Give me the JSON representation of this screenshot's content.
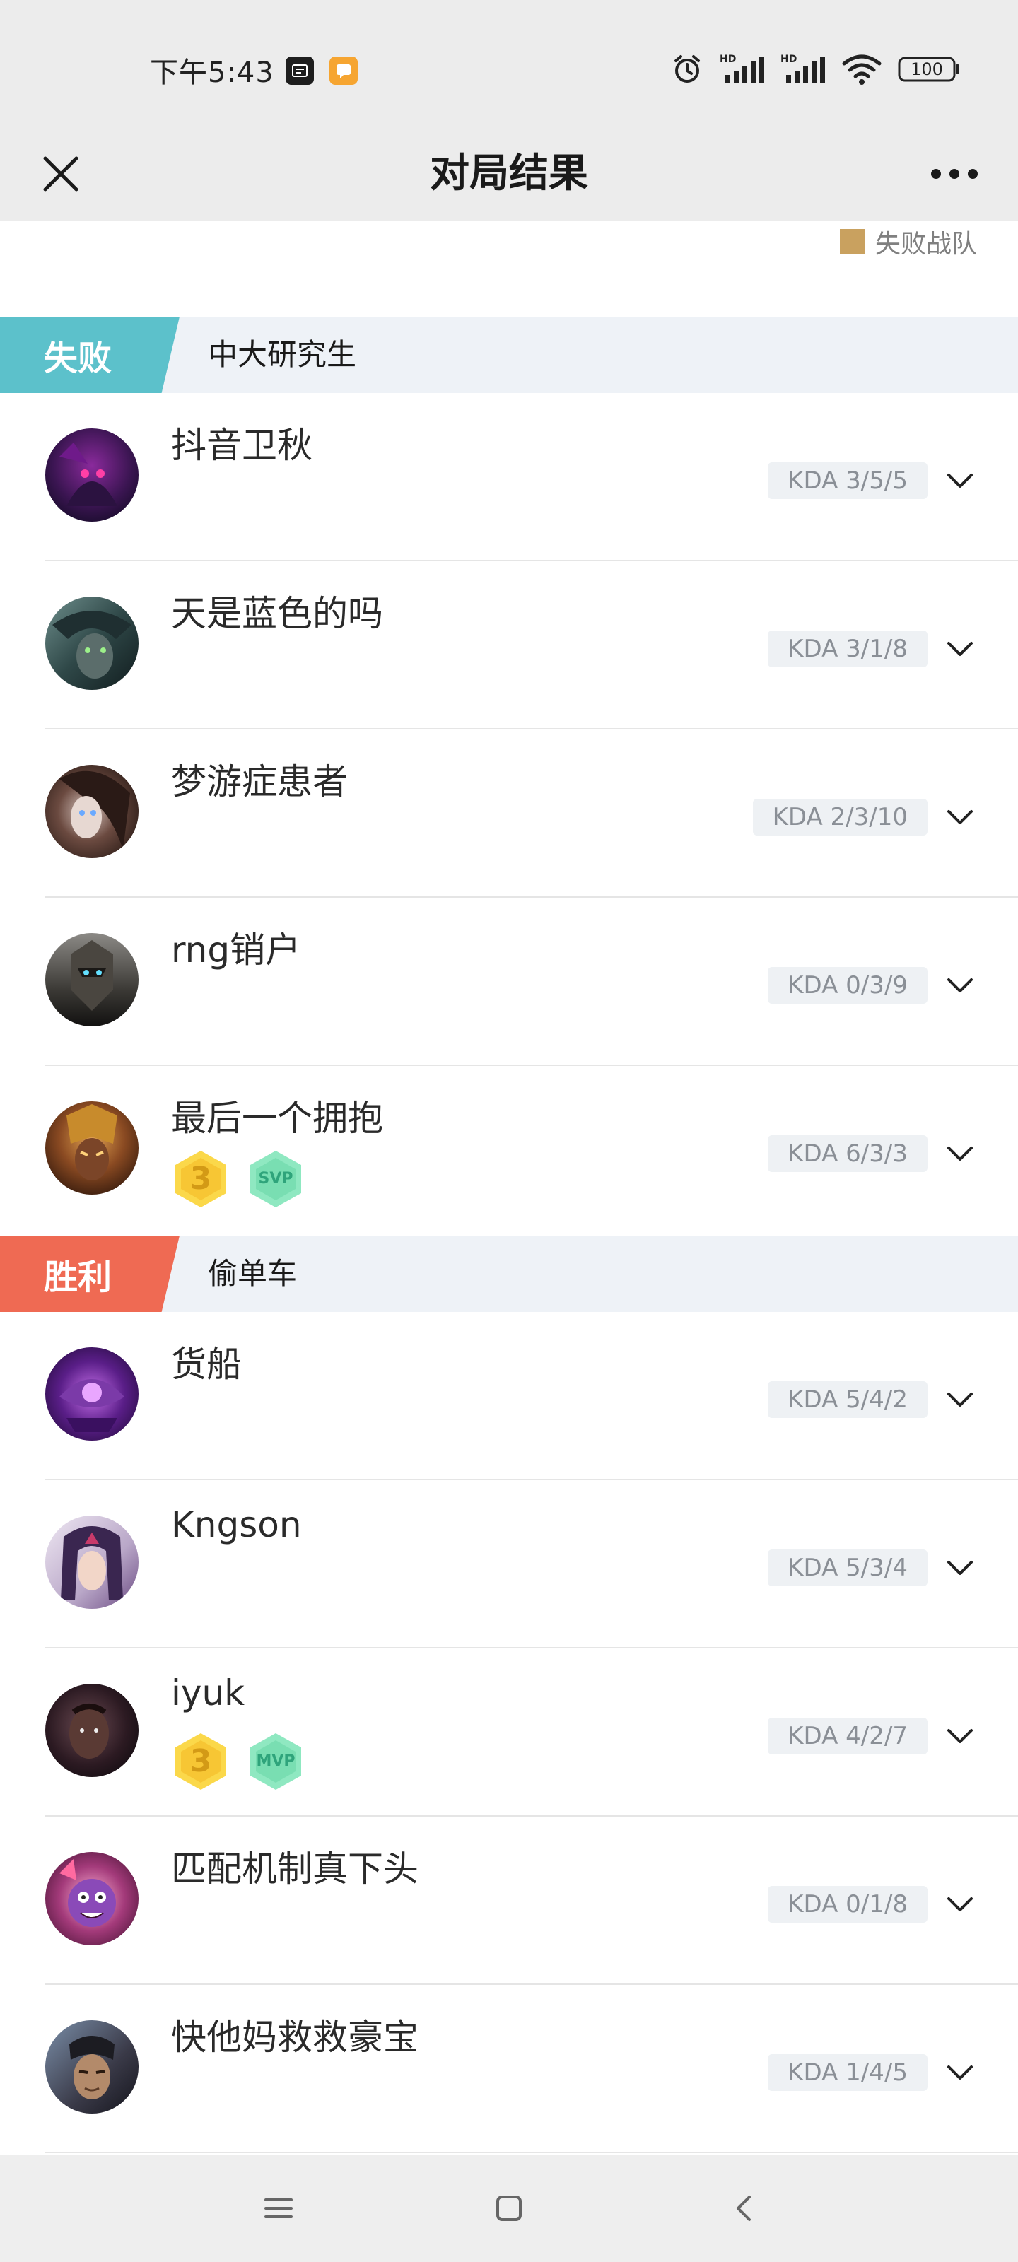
{
  "status_bar": {
    "time": "下午5:43",
    "battery": "100"
  },
  "header": {
    "title": "对局结果"
  },
  "legend": {
    "label": "失败战队",
    "color": "#c9a15f"
  },
  "teams": [
    {
      "result": "失败",
      "name": "中大研究生",
      "color": "#5cc1cb",
      "players": [
        {
          "name": "抖音卫秋",
          "kda": "KDA 3/5/5",
          "badges": []
        },
        {
          "name": "天是蓝色的吗",
          "kda": "KDA 3/1/8",
          "badges": []
        },
        {
          "name": "梦游症患者",
          "kda": "KDA 2/3/10",
          "badges": []
        },
        {
          "name": "rng销户",
          "kda": "KDA 0/3/9",
          "badges": []
        },
        {
          "name": "最后一个拥抱",
          "kda": "KDA 6/3/3",
          "badges": [
            "3",
            "SVP"
          ]
        }
      ]
    },
    {
      "result": "胜利",
      "name": "偷单车",
      "color": "#ef6a53",
      "players": [
        {
          "name": "货船",
          "kda": "KDA 5/4/2",
          "badges": []
        },
        {
          "name": "Kngson",
          "kda": "KDA 5/3/4",
          "badges": []
        },
        {
          "name": "iyuk",
          "kda": "KDA 4/2/7",
          "badges": [
            "3",
            "MVP"
          ]
        },
        {
          "name": "匹配机制真下头",
          "kda": "KDA 0/1/8",
          "badges": []
        },
        {
          "name": "快他妈救救豪宝",
          "kda": "KDA 1/4/5",
          "badges": []
        }
      ]
    }
  ]
}
